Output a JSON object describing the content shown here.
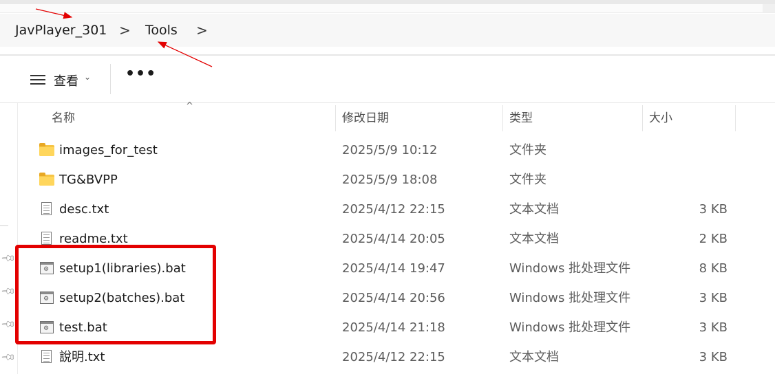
{
  "breadcrumb": {
    "items": [
      "JavPlayer_301",
      "Tools"
    ],
    "separator": ">"
  },
  "toolbar": {
    "view_label": "查看",
    "view_caret": "⌄",
    "more_label": "•••"
  },
  "columns": {
    "name": "名称",
    "date": "修改日期",
    "type": "类型",
    "size": "大小",
    "sort_indicator": "^"
  },
  "files": [
    {
      "icon": "folder-icon",
      "name": "images_for_test",
      "date": "2025/5/9 10:12",
      "type": "文件夹",
      "size": ""
    },
    {
      "icon": "folder-icon",
      "name": "TG&BVPP",
      "date": "2025/5/9 18:08",
      "type": "文件夹",
      "size": ""
    },
    {
      "icon": "text-file-icon",
      "name": "desc.txt",
      "date": "2025/4/12 22:15",
      "type": "文本文档",
      "size": "3 KB"
    },
    {
      "icon": "text-file-icon",
      "name": "readme.txt",
      "date": "2025/4/14 20:05",
      "type": "文本文档",
      "size": "2 KB"
    },
    {
      "icon": "batch-file-icon",
      "name": "setup1(libraries).bat",
      "date": "2025/4/14 19:47",
      "type": "Windows 批处理文件",
      "size": "8 KB"
    },
    {
      "icon": "batch-file-icon",
      "name": "setup2(batches).bat",
      "date": "2025/4/14 20:56",
      "type": "Windows 批处理文件",
      "size": "3 KB"
    },
    {
      "icon": "batch-file-icon",
      "name": "test.bat",
      "date": "2025/4/14 21:18",
      "type": "Windows 批处理文件",
      "size": "3 KB"
    },
    {
      "icon": "text-file-icon",
      "name": "說明.txt",
      "date": "2025/4/12 22:15",
      "type": "文本文档",
      "size": "3 KB"
    }
  ],
  "colors": {
    "highlight_box": "#e30000",
    "annotation_arrow": "#e30000",
    "folder": "#ffd65c"
  }
}
